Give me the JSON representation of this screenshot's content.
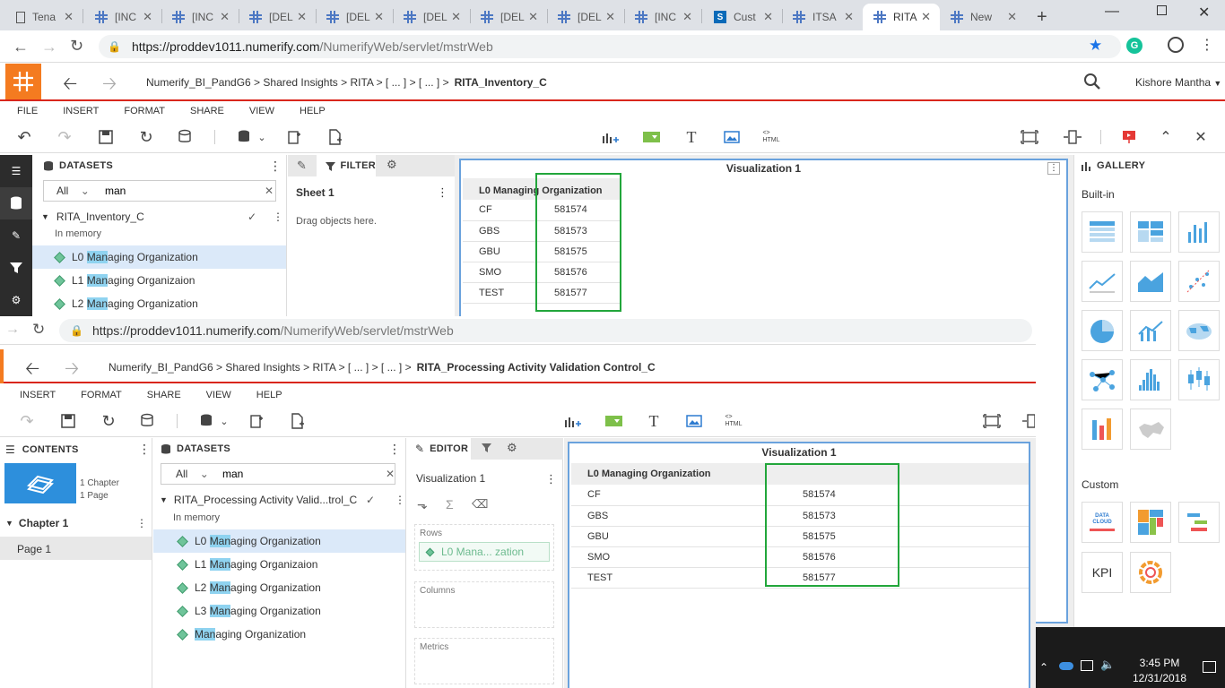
{
  "browser": {
    "tabs": [
      {
        "label": "Tena",
        "icon": "document-icon"
      },
      {
        "label": "[INC",
        "icon": "grid-icon"
      },
      {
        "label": "[INC",
        "icon": "grid-icon"
      },
      {
        "label": "[DEL",
        "icon": "grid-icon"
      },
      {
        "label": "[DEL",
        "icon": "grid-icon"
      },
      {
        "label": "[DEL",
        "icon": "grid-icon"
      },
      {
        "label": "[DEL",
        "icon": "grid-icon"
      },
      {
        "label": "[DEL",
        "icon": "grid-icon"
      },
      {
        "label": "[INC",
        "icon": "grid-icon"
      },
      {
        "label": "Cust",
        "icon": "sharepoint-icon"
      },
      {
        "label": "ITSA",
        "icon": "grid-icon"
      },
      {
        "label": "RITA",
        "icon": "grid-icon",
        "active": true
      },
      {
        "label": "New",
        "icon": "grid-icon"
      }
    ],
    "url_host": "https://proddev1011.numerify.com",
    "url_path": "/NumerifyWeb/servlet/mstrWeb"
  },
  "app1": {
    "breadcrumb": {
      "path": "Numerify_BI_PandG6  >  Shared Insights  >  RITA  >  [ ... ]  >  [ ... ]  >",
      "current": "RITA_Inventory_C"
    },
    "user": "Kishore Mantha",
    "menu": [
      "FILE",
      "INSERT",
      "FORMAT",
      "SHARE",
      "VIEW",
      "HELP"
    ],
    "datasets": {
      "title": "DATASETS",
      "filter_value": "All",
      "search_value": "man",
      "dataset_name": "RITA_Inventory_C",
      "in_memory": "In memory",
      "items": [
        {
          "pre": "L0 ",
          "hl": "Man",
          "post": "aging Organization"
        },
        {
          "pre": "L1 ",
          "hl": "Man",
          "post": "aging Organizaion"
        },
        {
          "pre": "L2 ",
          "hl": "Man",
          "post": "aging Organization"
        }
      ]
    },
    "filter_tab": "FILTER",
    "sheet_title": "Sheet 1",
    "drag_hint": "Drag objects here.",
    "viz_title": "Visualization 1",
    "grid": {
      "header": "L0 Managing Organization",
      "rows": [
        {
          "name": "CF",
          "value": "581574"
        },
        {
          "name": "GBS",
          "value": "581573"
        },
        {
          "name": "GBU",
          "value": "581575"
        },
        {
          "name": "SMO",
          "value": "581576"
        },
        {
          "name": "TEST",
          "value": "581577"
        }
      ]
    },
    "gallery": {
      "title": "GALLERY",
      "builtin": "Built-in",
      "custom": "Custom",
      "kpi": "KPI",
      "datacloud": "DATA CLOUD"
    }
  },
  "app2": {
    "url_host": "https://proddev1011.numerify.com",
    "url_path": "/NumerifyWeb/servlet/mstrWeb",
    "breadcrumb": {
      "path": "Numerify_BI_PandG6  >  Shared Insights  >  RITA  >  [ ... ]  >  [ ... ]  >",
      "current": "RITA_Processing Activity Validation Control_C"
    },
    "menu": [
      "INSERT",
      "FORMAT",
      "SHARE",
      "VIEW",
      "HELP"
    ],
    "contents": {
      "title": "CONTENTS",
      "chapters": "1 Chapter",
      "pages": "1 Page",
      "chapter": "Chapter 1",
      "page": "Page 1"
    },
    "datasets": {
      "title": "DATASETS",
      "filter_value": "All",
      "search_value": "man",
      "dataset_name": "RITA_Processing Activity Valid...trol_C",
      "in_memory": "In memory",
      "items": [
        {
          "pre": "L0 ",
          "hl": "Man",
          "post": "aging Organization"
        },
        {
          "pre": "L1 ",
          "hl": "Man",
          "post": "aging Organizaion"
        },
        {
          "pre": "L2 ",
          "hl": "Man",
          "post": "aging Organization"
        },
        {
          "pre": "L3 ",
          "hl": "Man",
          "post": "aging Organization"
        },
        {
          "pre": "",
          "hl": "Man",
          "post": "aging Organization"
        }
      ]
    },
    "editor": {
      "tab": "EDITOR",
      "viz": "Visualization 1",
      "rows_label": "Rows",
      "rows_chip": "L0 Mana...  zation",
      "columns_label": "Columns",
      "metrics_label": "Metrics"
    },
    "viz_title": "Visualization 1",
    "grid": {
      "header": "L0 Managing Organization",
      "rows": [
        {
          "name": "CF",
          "value": "581574"
        },
        {
          "name": "GBS",
          "value": "581573"
        },
        {
          "name": "GBU",
          "value": "581575"
        },
        {
          "name": "SMO",
          "value": "581576"
        },
        {
          "name": "TEST",
          "value": "581577"
        }
      ]
    }
  },
  "taskbar": {
    "time": "3:45 PM",
    "date": "12/31/2018"
  }
}
